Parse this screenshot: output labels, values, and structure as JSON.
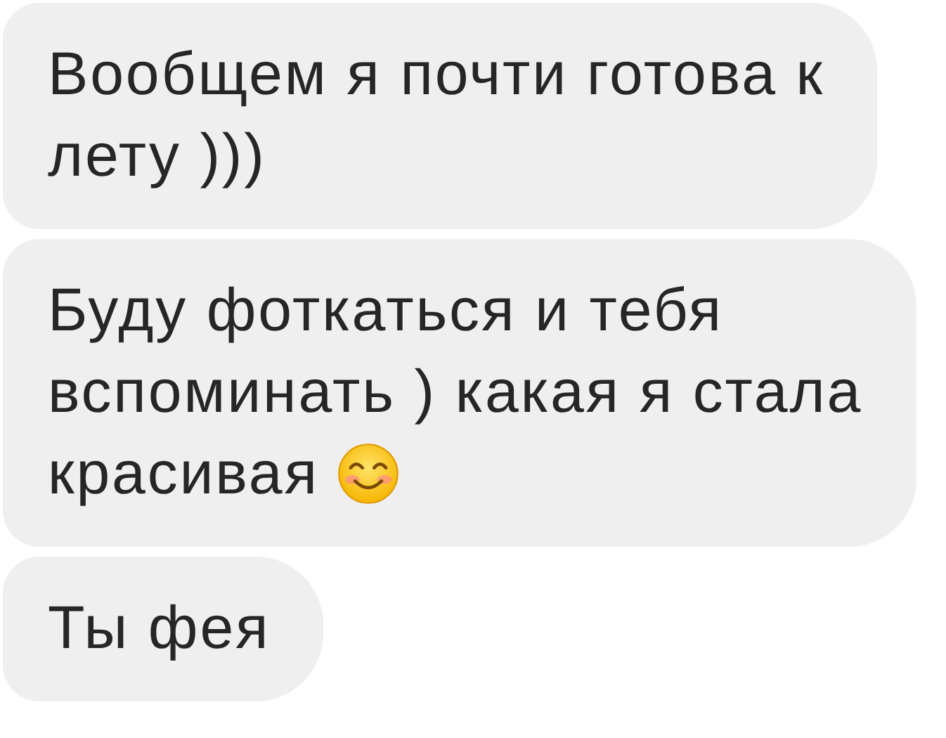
{
  "messages": [
    {
      "lines": [
        "Вообщем я почти готова к",
        "лету )))"
      ]
    },
    {
      "lines": [
        "Буду фоткаться и тебя",
        "вспоминать ) какая я стала",
        "красивая"
      ],
      "emoji": true
    },
    {
      "lines": [
        "Ты фея"
      ]
    }
  ]
}
